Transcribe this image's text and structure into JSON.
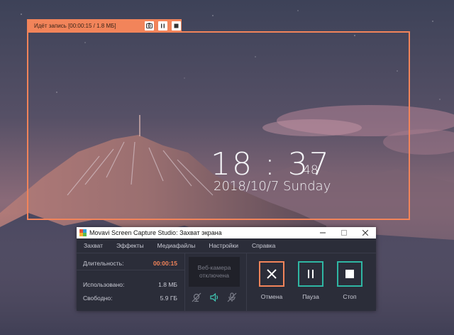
{
  "desktop": {
    "clock_time": "18 : 37",
    "clock_seconds": "48",
    "clock_date": "2018/10/7 Sunday"
  },
  "recording": {
    "status": "Идёт запись [00:00:15 / 1.8 МБ]",
    "accent_color": "#f2845a"
  },
  "window": {
    "title": "Movavi Screen Capture Studio: Захват экрана",
    "menu": [
      "Захват",
      "Эффекты",
      "Медиафайлы",
      "Настройки",
      "Справка"
    ],
    "stats": {
      "duration_label": "Длительность:",
      "duration_value": "00:00:15",
      "used_label": "Использовано:",
      "used_value": "1.8 МБ",
      "free_label": "Свободно:",
      "free_value": "5.9 ГБ"
    },
    "webcam_text": "Веб-камера отключена",
    "sources": [
      "webcam-off-icon",
      "speaker-icon",
      "microphone-off-icon"
    ],
    "buttons": {
      "cancel": "Отмена",
      "pause": "Пауза",
      "stop": "Стоп"
    }
  }
}
